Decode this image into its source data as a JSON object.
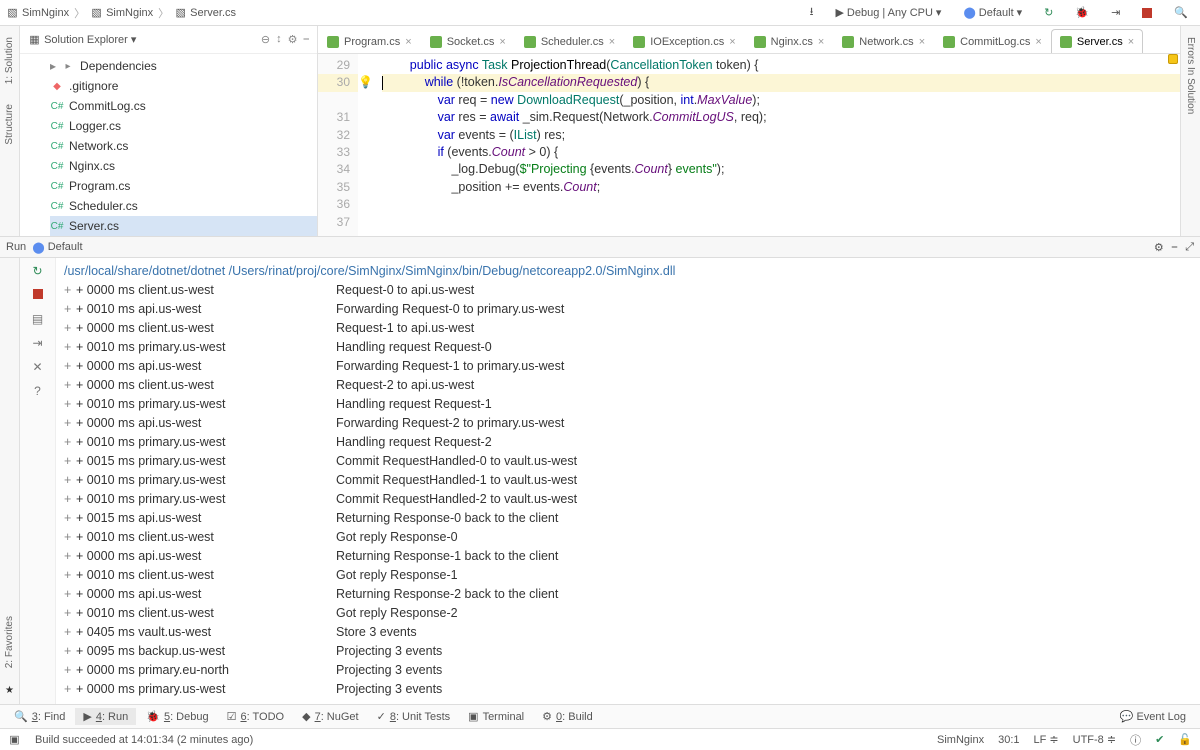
{
  "breadcrumbs": [
    "SimNginx",
    "SimNginx",
    "Server.cs"
  ],
  "toolbar": {
    "config": "Debug | Any CPU",
    "run_cfg": "Default"
  },
  "side_tabs_left": [
    "1: Solution",
    "Structure"
  ],
  "side_tabs_right": [
    "Errors In Solution"
  ],
  "side_tabs_bl": [
    "2: Favorites"
  ],
  "explorer": {
    "title": "Solution Explorer",
    "items": [
      {
        "label": "Dependencies",
        "icon": "dep",
        "expand": true
      },
      {
        "label": ".gitignore",
        "icon": "git"
      },
      {
        "label": "CommitLog.cs",
        "icon": "cs"
      },
      {
        "label": "Logger.cs",
        "icon": "cs"
      },
      {
        "label": "Network.cs",
        "icon": "cs"
      },
      {
        "label": "Nginx.cs",
        "icon": "cs"
      },
      {
        "label": "Program.cs",
        "icon": "cs"
      },
      {
        "label": "Scheduler.cs",
        "icon": "cs"
      },
      {
        "label": "Server.cs",
        "icon": "cs",
        "sel": true
      }
    ]
  },
  "tabs": [
    {
      "label": "Program.cs"
    },
    {
      "label": "Socket.cs"
    },
    {
      "label": "Scheduler.cs"
    },
    {
      "label": "IOException.cs"
    },
    {
      "label": "Nginx.cs"
    },
    {
      "label": "Network.cs"
    },
    {
      "label": "CommitLog.cs"
    },
    {
      "label": "Server.cs",
      "active": true
    }
  ],
  "gutter": [
    "29",
    "30",
    "31",
    "32",
    "33",
    "34",
    "35",
    "36",
    "37"
  ],
  "code_lines": [
    {
      "html": "        <span class='kw'>public</span> <span class='kw'>async</span> <span class='ty'>Task</span> <span class='fn'>ProjectionThread</span>(<span class='ty'>CancellationToken</span> token) {"
    },
    {
      "html": "            <span class='kw'>while</span> (!token.<span class='id'>IsCancellationRequested</span>) {",
      "hl": true,
      "cursor": true
    },
    {
      "html": "                <span class='kw'>var</span> req = <span class='kw'>new</span> <span class='ty'>DownloadRequest</span>(_position, <span class='kw'>int</span>.<span class='id'>MaxValue</span>);"
    },
    {
      "html": "                <span class='kw'>var</span> res = <span class='kw'>await</span> _sim.Request(Network.<span class='id'>CommitLogUS</span>, req);"
    },
    {
      "html": "                <span class='kw'>var</span> events = (<span class='ty'>IList</span>) res;"
    },
    {
      "html": ""
    },
    {
      "html": "                <span class='kw'>if</span> (events.<span class='id'>Count</span> &gt; 0) {"
    },
    {
      "html": "                    _log.Debug(<span class='str'>$\"Projecting </span>{events.<span class='id'>Count</span>}<span class='str'> events\"</span>);"
    },
    {
      "html": "                    _position += events.<span class='id'>Count</span>;"
    }
  ],
  "run": {
    "title_left": "Run",
    "title_cfg": "Default",
    "cmd": "/usr/local/share/dotnet/dotnet /Users/rinat/proj/core/SimNginx/SimNginx/bin/Debug/netcoreapp2.0/SimNginx.dll",
    "rows": [
      {
        "ts": "+ 0000 ms client.us-west",
        "msg": "Request-0 to api.us-west"
      },
      {
        "ts": "+ 0010 ms api.us-west",
        "msg": "Forwarding Request-0 to primary.us-west"
      },
      {
        "ts": "+ 0000 ms client.us-west",
        "msg": "Request-1 to api.us-west"
      },
      {
        "ts": "+ 0010 ms primary.us-west",
        "msg": "Handling request Request-0"
      },
      {
        "ts": "+ 0000 ms api.us-west",
        "msg": "Forwarding Request-1 to primary.us-west"
      },
      {
        "ts": "+ 0000 ms client.us-west",
        "msg": "Request-2 to api.us-west"
      },
      {
        "ts": "+ 0010 ms primary.us-west",
        "msg": "Handling request Request-1"
      },
      {
        "ts": "+ 0000 ms api.us-west",
        "msg": "Forwarding Request-2 to primary.us-west"
      },
      {
        "ts": "+ 0010 ms primary.us-west",
        "msg": "Handling request Request-2"
      },
      {
        "ts": "+ 0015 ms primary.us-west",
        "msg": "Commit RequestHandled-0 to vault.us-west"
      },
      {
        "ts": "+ 0010 ms primary.us-west",
        "msg": "Commit RequestHandled-1 to vault.us-west"
      },
      {
        "ts": "+ 0010 ms primary.us-west",
        "msg": "Commit RequestHandled-2 to vault.us-west"
      },
      {
        "ts": "+ 0015 ms api.us-west",
        "msg": "Returning Response-0 back to the client"
      },
      {
        "ts": "+ 0010 ms client.us-west",
        "msg": "Got reply Response-0"
      },
      {
        "ts": "+ 0000 ms api.us-west",
        "msg": "Returning Response-1 back to the client"
      },
      {
        "ts": "+ 0010 ms client.us-west",
        "msg": "Got reply Response-1"
      },
      {
        "ts": "+ 0000 ms api.us-west",
        "msg": "Returning Response-2 back to the client"
      },
      {
        "ts": "+ 0010 ms client.us-west",
        "msg": "Got reply Response-2"
      },
      {
        "ts": "+ 0405 ms vault.us-west",
        "msg": "Store 3 events"
      },
      {
        "ts": "+ 0095 ms backup.us-west",
        "msg": "Projecting 3 events"
      },
      {
        "ts": "+ 0000 ms primary.eu-north",
        "msg": "Projecting 3 events"
      },
      {
        "ts": "+ 0000 ms primary.us-west",
        "msg": "Projecting 3 events"
      }
    ]
  },
  "toolwindows": [
    {
      "label": "3: Find",
      "icon": "🔍"
    },
    {
      "label": "4: Run",
      "icon": "▶",
      "active": true
    },
    {
      "label": "5: Debug",
      "icon": "🐞"
    },
    {
      "label": "6: TODO",
      "icon": "☑"
    },
    {
      "label": "7: NuGet",
      "icon": "◆"
    },
    {
      "label": "8: Unit Tests",
      "icon": "✓"
    },
    {
      "label": "Terminal",
      "icon": "▣"
    },
    {
      "label": "0: Build",
      "icon": "⚙"
    }
  ],
  "event_log": "Event Log",
  "status": {
    "msg": "Build succeeded at 14:01:34 (2 minutes ago)",
    "proj": "SimNginx",
    "pos": "30:1",
    "eol": "LF",
    "enc": "UTF-8"
  }
}
